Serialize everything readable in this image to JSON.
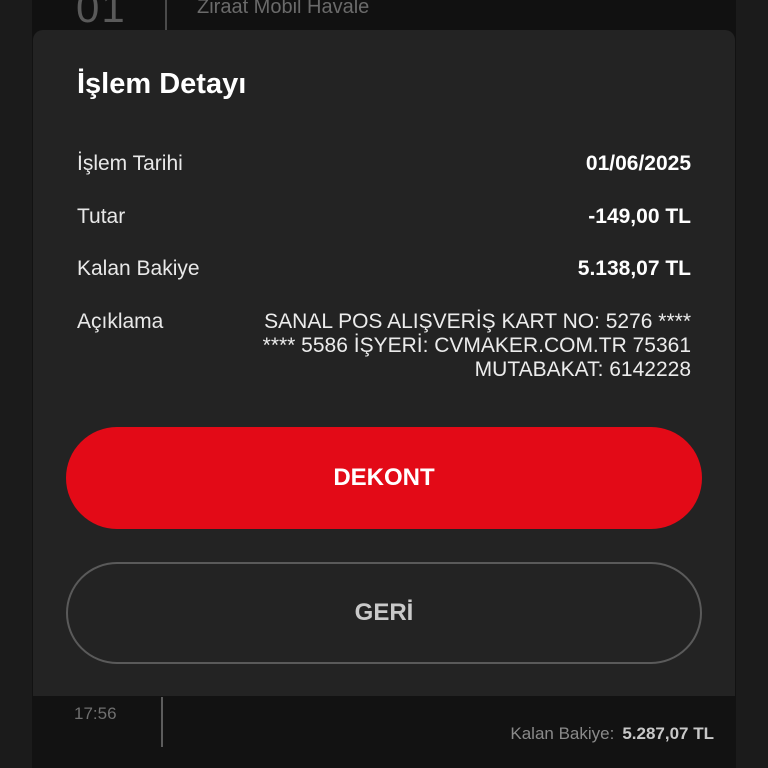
{
  "background": {
    "top_row": {
      "day": "01",
      "title": "Ziraat Mobil Havale"
    },
    "bottom_row": {
      "time": "17:56",
      "balance_label": "Kalan Bakiye:",
      "balance_value": "5.287,07 TL"
    }
  },
  "modal": {
    "title": "İşlem Detayı",
    "rows": [
      {
        "label": "İşlem Tarihi",
        "value": "01/06/2025"
      },
      {
        "label": "Tutar",
        "value": "-149,00 TL"
      },
      {
        "label": "Kalan Bakiye",
        "value": "5.138,07 TL"
      }
    ],
    "description": {
      "label": "Açıklama",
      "lines": [
        "SANAL POS ALIŞVERİŞ KART NO: 5276 ****",
        "**** 5586 İŞYERİ: CVMAKER.COM.TR 75361",
        "MUTABAKAT: 6142228"
      ]
    },
    "primary_button": "DEKONT",
    "secondary_button": "GERİ"
  },
  "colors": {
    "accent": "#e30a17",
    "modal_bg": "#232323",
    "page_bg": "#121212"
  }
}
